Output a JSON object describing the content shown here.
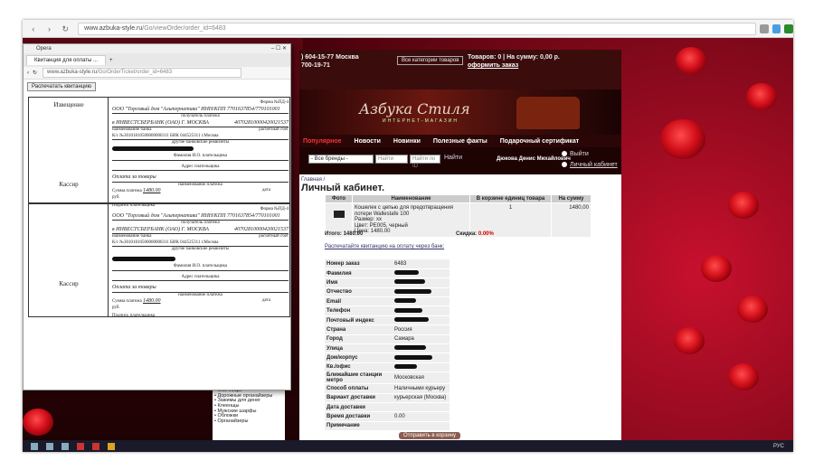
{
  "outer_browser": {
    "url_base": "www.azbuka-style.ru",
    "url_path": "/Go/viewOrder/order_id=6483"
  },
  "taskbar": {
    "lang": "РУС"
  },
  "popup": {
    "title": "Opera",
    "tab": "Квитанция для оплаты ...",
    "url_base": "www.azbuka-style.ru",
    "url_path": "/Go/OrderTicket/order_id=6483",
    "print_button": "Распечатать квитанцию",
    "receipt": {
      "top_label": "Извещение",
      "bottom_label": "Кассир",
      "form_label": "Форма №ПД-4",
      "company": "ООО \"Торговый дом \"Альтернатива\" ИНН/КПП 7701637854/770101001",
      "recipient_caption": "получатель платежа",
      "bank": "в ИНВЕСТСБЕРБАНК (ОАО) Г. МОСКВА",
      "account": "40702810000420021537",
      "account_caption": "расчетный счет",
      "bank_caption": "наименование банка",
      "corr": "К/с №30101810500000000311  БИК 044525311  г.Москва",
      "other_req": "другие банковские реквизиты",
      "payer_caption": "Фамилия И.О. плательщика",
      "address_caption": "Адрес плательщика",
      "purpose": "Оплата за товары",
      "purpose_caption": "наименование платежа",
      "sum_label": "Сумма платежа",
      "sum": "1480.00",
      "currency": "руб.",
      "date_caption": "дата",
      "sign": "Подпись плательщика",
      "check_label": "Кассир",
      "second_label": "Квитанция"
    }
  },
  "site": {
    "phone1": ") 604-15-77 Москва",
    "phone2": "700-19-71",
    "all_categories": "Все категории товаров",
    "cart_line1": "Товаров: 0  |  На сумму:",
    "cart_sum": "0,00 р.",
    "cart_link": "оформить заказ",
    "logo": "Азбука Стиля",
    "tagline": "ИНТЕРНЕТ-МАГАЗИН",
    "nav": [
      "Популярное",
      "Новости",
      "Новинки",
      "Полезные факты",
      "Подарочный сертификат"
    ],
    "brand_select": "- Все бренды -",
    "search_placeholder": "Найти",
    "search_placeholder2": "Найти по ID",
    "search_go": "Найти",
    "user": "Дюкова Денис Михайлович",
    "exit": "Выйти",
    "cabinet": "Личный кабинет",
    "breadcrumb": "Главная /",
    "page_title": "Личный кабинет.",
    "order_table": {
      "headers": [
        "Фото",
        "Наименование",
        "В корзине единиц товара",
        "На сумму"
      ],
      "row": {
        "name": "Кошелек с цепью для предотвращения потери Wallestafe 100",
        "size": "Размер: xx",
        "color": "Цвет: PE005, черный",
        "price": "Цена: 1480.00",
        "qty": "1",
        "sum": "1480,00"
      }
    },
    "total_label": "Итого:",
    "total": "1480.00",
    "discount_label": "Скидка:",
    "discount": "0.00%",
    "print_link": "Распечатайте квитанцию на оплату через банк:",
    "details": [
      {
        "k": "Номер заказ",
        "v": "6483"
      },
      {
        "k": "Фамилия",
        "v": ""
      },
      {
        "k": "Имя",
        "v": ""
      },
      {
        "k": "Отчество",
        "v": ""
      },
      {
        "k": "Email",
        "v": ""
      },
      {
        "k": "Телефон",
        "v": ""
      },
      {
        "k": "Почтовый индекс",
        "v": ""
      },
      {
        "k": "Страна",
        "v": "Россия"
      },
      {
        "k": "Город",
        "v": "Самара"
      },
      {
        "k": "Улица",
        "v": ""
      },
      {
        "k": "Дом/корпус",
        "v": ""
      },
      {
        "k": "Кв./офис",
        "v": ""
      },
      {
        "k": "Ближайшие станции метро",
        "v": "Московская"
      },
      {
        "k": "Способ оплаты",
        "v": "Наличными курьеру"
      },
      {
        "k": "Вариант доставки",
        "v": "курьерская (Москва)"
      },
      {
        "k": "Дата доставки",
        "v": ""
      },
      {
        "k": "Время доставки",
        "v": "0.00"
      },
      {
        "k": "Примечание",
        "v": ""
      }
    ],
    "basket_button": "Отправить в корзину"
  },
  "side_menu": [
    "Визитницы",
    "Бумажники и портмоне",
    "Ключницы",
    "Дорожные органайзеры",
    "Зажимы для денег",
    "Клеенщы",
    "Мужские шарфы",
    "Обложки",
    "Органайзеры"
  ]
}
